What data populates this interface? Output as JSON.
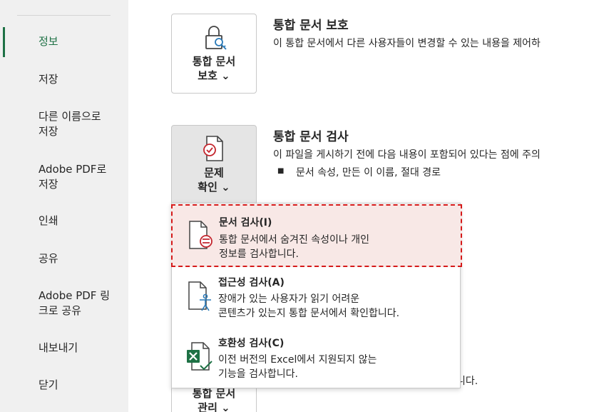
{
  "sidebar": {
    "items": [
      {
        "label": "정보",
        "active": true
      },
      {
        "label": "저장"
      },
      {
        "label_lines": [
          "다른 이름으로",
          "저장"
        ]
      },
      {
        "label_lines": [
          "Adobe PDF로",
          "저장"
        ]
      },
      {
        "label": "인쇄"
      },
      {
        "label": "공유"
      },
      {
        "label_lines": [
          "Adobe PDF 링",
          "크로 공유"
        ]
      },
      {
        "label": "내보내기"
      },
      {
        "label": "닫기"
      }
    ],
    "accent_color": "#1e7145"
  },
  "protect": {
    "button_lines": [
      "통합 문서",
      "보호 ⌄"
    ],
    "icon": "lock-key-icon",
    "title": "통합 문서 보호",
    "description": "이 통합 문서에서 다른 사용자들이 변경할 수 있는 내용을 제어하"
  },
  "inspect": {
    "button_lines": [
      "문제",
      "확인 ⌄"
    ],
    "icon": "document-check-icon",
    "title": "통합 문서 검사",
    "description": "이 파일을 게시하기 전에 다음 내용이 포함되어 있다는 점에 주의",
    "bullet": "■",
    "bullet_text": "문서 속성, 만든 이 이름, 절대 경로"
  },
  "menu": {
    "items": [
      {
        "title": "문서 검사(I)",
        "desc_lines": [
          "통합 문서에서 숨겨진 속성이나 개인",
          "정보를 검사합니다."
        ],
        "icon": "document-inspect-icon",
        "highlighted": true
      },
      {
        "title": "접근성 검사(A)",
        "desc_lines": [
          "장애가 있는 사용자가 읽기 어려운",
          "콘텐츠가 있는지 통합 문서에서 확인합니다."
        ],
        "icon": "accessibility-icon"
      },
      {
        "title": "호환성 검사(C)",
        "desc_lines": [
          "이전 버전의 Excel에서 지원되지 않는",
          "기능을 검사합니다."
        ],
        "icon": "excel-compat-icon"
      }
    ],
    "highlight_color": "#d51a1a"
  },
  "manage": {
    "button_lines": [
      "통합 문서",
      "관리 ⌄"
    ],
    "behind_text": "니다."
  }
}
